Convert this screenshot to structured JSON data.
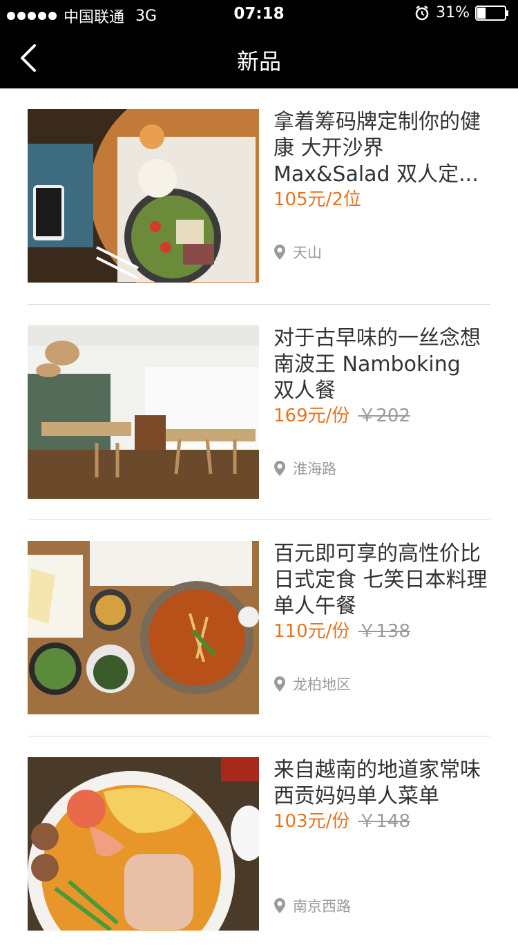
{
  "status_bar": {
    "carrier": "中国联通",
    "network": "3G",
    "time": "07:18",
    "battery": "31%",
    "battery_level": 0.31
  },
  "nav": {
    "title": "新品",
    "back_icon": "chevron-left-icon"
  },
  "colors": {
    "price": "#e7741d",
    "muted": "#9a9a9a",
    "title": "#333333",
    "bar": "#000000"
  },
  "deals": [
    {
      "title": "拿着筹码牌定制你的健康 大开沙界 Max&Salad 双人定...",
      "price": "105元/2位",
      "original_price": "",
      "location": "天山"
    },
    {
      "title": "对于古早味的一丝念想 南波王 Namboking 双人餐",
      "price": "169元/份",
      "original_price": "￥202",
      "location": "淮海路"
    },
    {
      "title": "百元即可享的高性价比日式定食 七笑日本料理单人午餐",
      "price": "110元/份",
      "original_price": "￥138",
      "location": "龙柏地区"
    },
    {
      "title": "来自越南的地道家常味 西贡妈妈单人菜单",
      "price": "103元/份",
      "original_price": "￥148",
      "location": "南京西路"
    }
  ]
}
